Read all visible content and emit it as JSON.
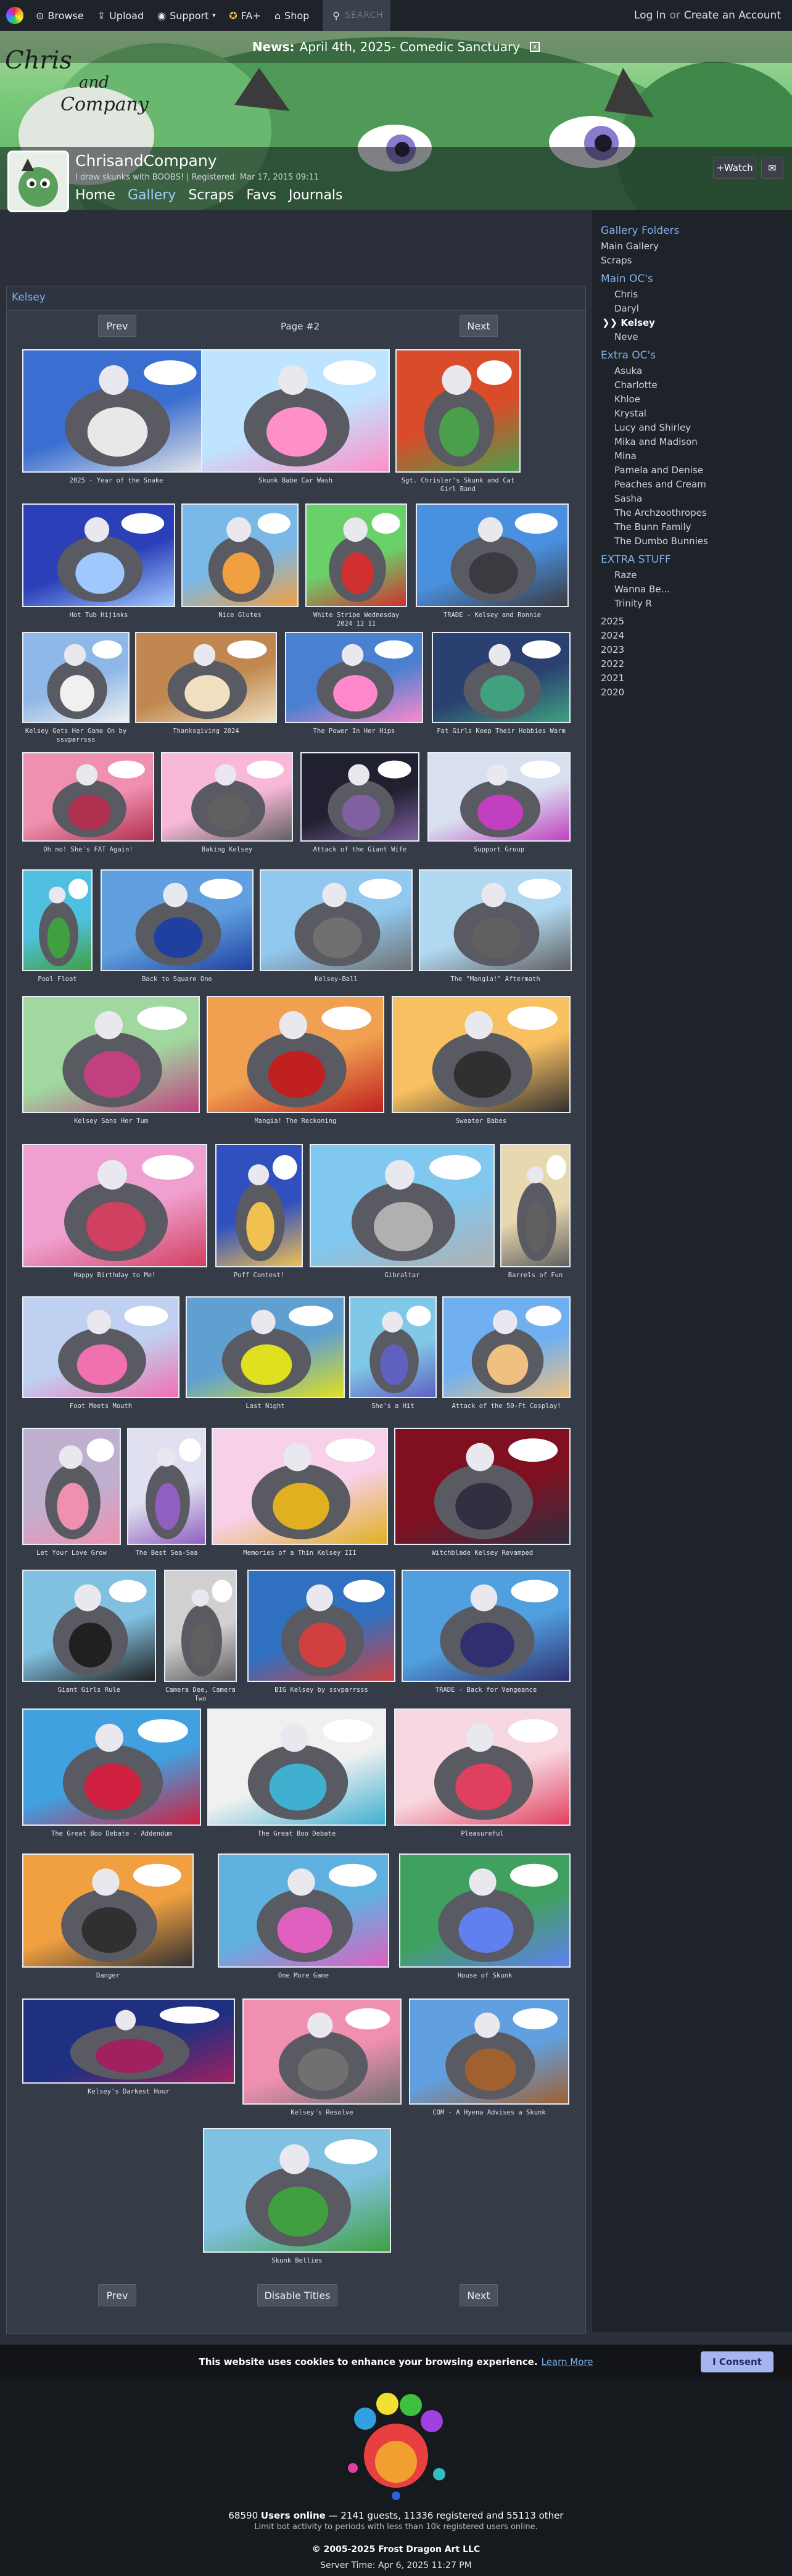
{
  "topbar": {
    "browse": "Browse",
    "upload": "Upload",
    "support": "Support",
    "fa_plus": "FA+",
    "shop": "Shop",
    "search_placeholder": "SEARCH",
    "login": "Log In",
    "or": "or",
    "create": "Create an Account"
  },
  "banner": {
    "logo_line1": "Chris",
    "logo_line2": "and",
    "logo_line3": "Company"
  },
  "news": {
    "label": "News:",
    "text": "April 4th, 2025- Comedic Sanctuary",
    "close": "x"
  },
  "profile": {
    "name": "ChrisandCompany",
    "tagline": "I draw skunks with BOOBS! | Registered: Mar 17, 2015 09:11",
    "nav": [
      "Home",
      "Gallery",
      "Scraps",
      "Favs",
      "Journals"
    ],
    "watch": "+Watch"
  },
  "panel": {
    "title": "Kelsey",
    "prev": "Prev",
    "next": "Next",
    "page": "Page #2",
    "disable_titles": "Disable Titles"
  },
  "gallery": [
    {
      "title": "2025 - Year of the Snake",
      "c1": "#3a6ed0",
      "c2": "#e8e8e8"
    },
    {
      "title": "Skunk Babe Car Wash",
      "c1": "#bfe4ff",
      "c2": "#ff8fc8"
    },
    {
      "title": "Sgt. Chrisler's Skunk and Cat Girl Band",
      "c1": "#d94c2a",
      "c2": "#4aa04a"
    },
    {
      "title": "Hot Tub Hijinks",
      "c1": "#2a3fb8",
      "c2": "#a0c8ff"
    },
    {
      "title": "Nice Glutes",
      "c1": "#7ab8e8",
      "c2": "#f0a040"
    },
    {
      "title": "White Stripe Wednesday 2024 12 11",
      "c1": "#6ad06a",
      "c2": "#d03030"
    },
    {
      "title": "TRADE - Kelsey and Ronnie",
      "c1": "#4a90e0",
      "c2": "#3a3a40"
    },
    {
      "title": "Kelsey Gets Her Game On by ssvparrsss",
      "c1": "#8fb8e8",
      "c2": "#f0f0f0"
    },
    {
      "title": "Thanksgiving 2024",
      "c1": "#c08850",
      "c2": "#f0e0c0"
    },
    {
      "title": "The Power In Her Hips",
      "c1": "#4a80d0",
      "c2": "#ff88cc"
    },
    {
      "title": "Fat Girls Keep Their Hobbies Warm",
      "c1": "#2a4070",
      "c2": "#40a080"
    },
    {
      "title": "Oh no! She's FAT Again!",
      "c1": "#f090b0",
      "c2": "#b03050"
    },
    {
      "title": "Baking Kelsey",
      "c1": "#f8b8d8",
      "c2": "#606060"
    },
    {
      "title": "Attack of the Giant Wife",
      "c1": "#202030",
      "c2": "#8060a0"
    },
    {
      "title": "Support Group",
      "c1": "#d8e0f0",
      "c2": "#c040c0"
    },
    {
      "title": "Pool Float",
      "c1": "#50c0e0",
      "c2": "#40a040"
    },
    {
      "title": "Back to Square One",
      "c1": "#60a0e0",
      "c2": "#2040a0"
    },
    {
      "title": "Kelsey-Ball",
      "c1": "#90c8f0",
      "c2": "#707070"
    },
    {
      "title": "The \"Mangia!\" Aftermath",
      "c1": "#b0d8f0",
      "c2": "#606060"
    },
    {
      "title": "Kelsey Sans Her Tum",
      "c1": "#a0d8a0",
      "c2": "#c04080"
    },
    {
      "title": "Mangia! The Reckoning",
      "c1": "#f0a050",
      "c2": "#c02020"
    },
    {
      "title": "Sweater Babes",
      "c1": "#f8c060",
      "c2": "#303030"
    },
    {
      "title": "Happy Birthday to Me!",
      "c1": "#f0a0d0",
      "c2": "#d04060"
    },
    {
      "title": "Puff Contest!",
      "c1": "#3050c0",
      "c2": "#f0c050"
    },
    {
      "title": "Gibraltar",
      "c1": "#80c8f0",
      "c2": "#b0b0b0"
    },
    {
      "title": "Barrels of Fun",
      "c1": "#e8d8b0",
      "c2": "#606060"
    },
    {
      "title": "Foot Meets Mouth",
      "c1": "#c0d0f0",
      "c2": "#f070b0"
    },
    {
      "title": "Last Night",
      "c1": "#60a0d0",
      "c2": "#e0e020"
    },
    {
      "title": "She's a Hit",
      "c1": "#80c8e8",
      "c2": "#6060c0"
    },
    {
      "title": "Attack of the 50-Ft Cosplay!",
      "c1": "#70b0f0",
      "c2": "#f0c080"
    },
    {
      "title": "Let Your Love Grow",
      "c1": "#c0b0d0",
      "c2": "#f090b0"
    },
    {
      "title": "The Best Sea-Sea",
      "c1": "#e0e0f0",
      "c2": "#9060c0"
    },
    {
      "title": "Memories of a Thin Kelsey III",
      "c1": "#f8d0e8",
      "c2": "#e0b020"
    },
    {
      "title": "Witchblade Kelsey Revamped",
      "c1": "#801020",
      "c2": "#303040"
    },
    {
      "title": "Giant Girls Rule",
      "c1": "#80c0e0",
      "c2": "#202020"
    },
    {
      "title": "Camera Dee, Camera Two",
      "c1": "#d0d0d0",
      "c2": "#606060"
    },
    {
      "title": "BIG Kelsey by ssvparrsss",
      "c1": "#3070c0",
      "c2": "#d04040"
    },
    {
      "title": "TRADE - Back for Vengeance",
      "c1": "#50a0e0",
      "c2": "#303070"
    },
    {
      "title": "The Great Boo Debate - Addendum",
      "c1": "#40a0e0",
      "c2": "#d02040"
    },
    {
      "title": "The Great Boo Debate",
      "c1": "#f0f0f0",
      "c2": "#40b0d0"
    },
    {
      "title": "Pleasureful",
      "c1": "#f8d8e0",
      "c2": "#e04060"
    },
    {
      "title": "Danger",
      "c1": "#f0a040",
      "c2": "#303030"
    },
    {
      "title": "One More Game",
      "c1": "#60b0e0",
      "c2": "#e060c0"
    },
    {
      "title": "House of Skunk",
      "c1": "#40a060",
      "c2": "#6080f0"
    },
    {
      "title": "Kelsey's Darkest Hour",
      "c1": "#203080",
      "c2": "#a02060"
    },
    {
      "title": "Kelsey's Resolve",
      "c1": "#f090b0",
      "c2": "#707070"
    },
    {
      "title": "COM - A Hyena Advises a Skunk",
      "c1": "#60a0e0",
      "c2": "#a06030"
    },
    {
      "title": "Skunk Bellies",
      "c1": "#80c0e0",
      "c2": "#40a040"
    }
  ],
  "sidebar": {
    "gallery_folders": "Gallery Folders",
    "main_gallery": "Main Gallery",
    "scraps": "Scraps",
    "main_ocs": "Main OC's",
    "main_list": [
      "Chris",
      "Daryl",
      "Kelsey",
      "Neve"
    ],
    "current_marker": "❯❯",
    "extra_ocs": "Extra OC's",
    "extra_list": [
      "Asuka",
      "Charlotte",
      "Khloe",
      "Krystal",
      "Lucy and Shirley",
      "Mika and Madison",
      "Mina",
      "Pamela and Denise",
      "Peaches and Cream",
      "Sasha",
      "The Archzoothropes",
      "The Bunn Family",
      "The Dumbo Bunnies"
    ],
    "extra_stuff": "EXTRA STUFF",
    "stuff_list": [
      "Raze",
      "Wanna Be...",
      "Trinity R"
    ],
    "years": [
      "2025",
      "2024",
      "2023",
      "2022",
      "2021",
      "2020"
    ]
  },
  "cookie": {
    "text": "This website uses cookies to enhance your browsing experience.",
    "learn_more": "Learn More",
    "consent": "I Consent"
  },
  "footer": {
    "online_count": "68590",
    "online_label": "Users online",
    "guests": "— 2141 guests, 11336 registered and 55113 other",
    "limit_note": "Limit bot activity to periods with less than 10k registered users online.",
    "copyright": "© 2005-2025 Frost Dragon Art LLC",
    "server_time": "Server Time: Apr 6, 2025 11:27 PM"
  }
}
